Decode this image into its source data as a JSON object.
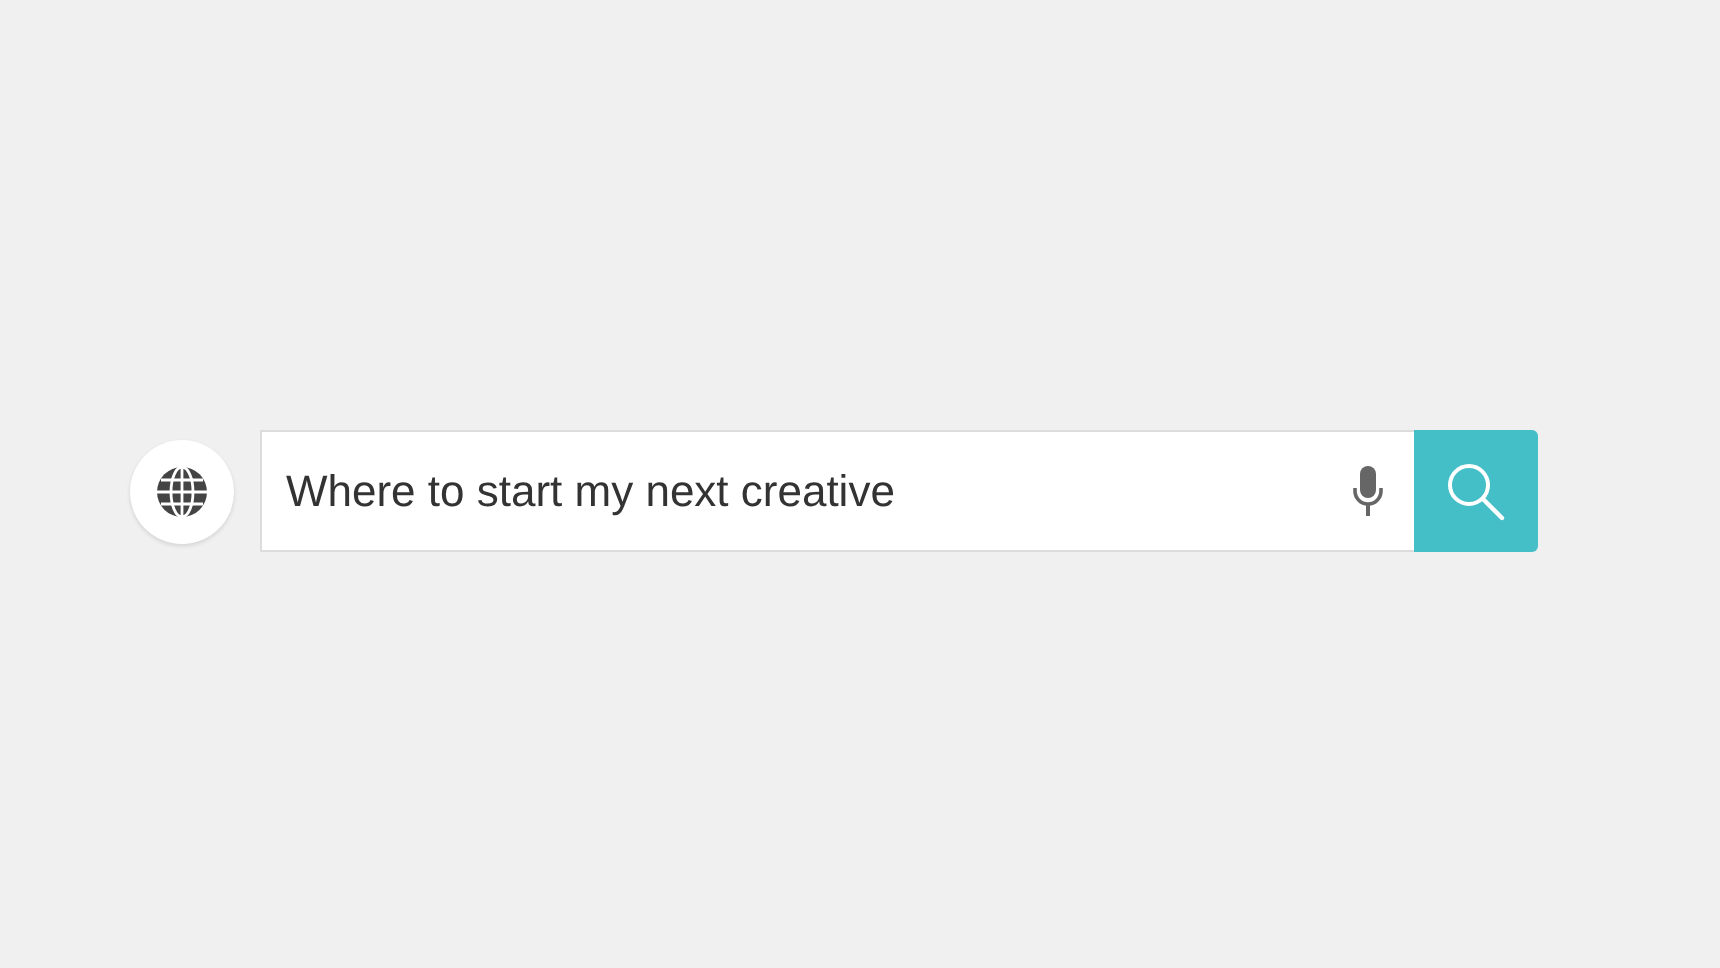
{
  "search": {
    "value": "Where to start my next creative"
  }
}
